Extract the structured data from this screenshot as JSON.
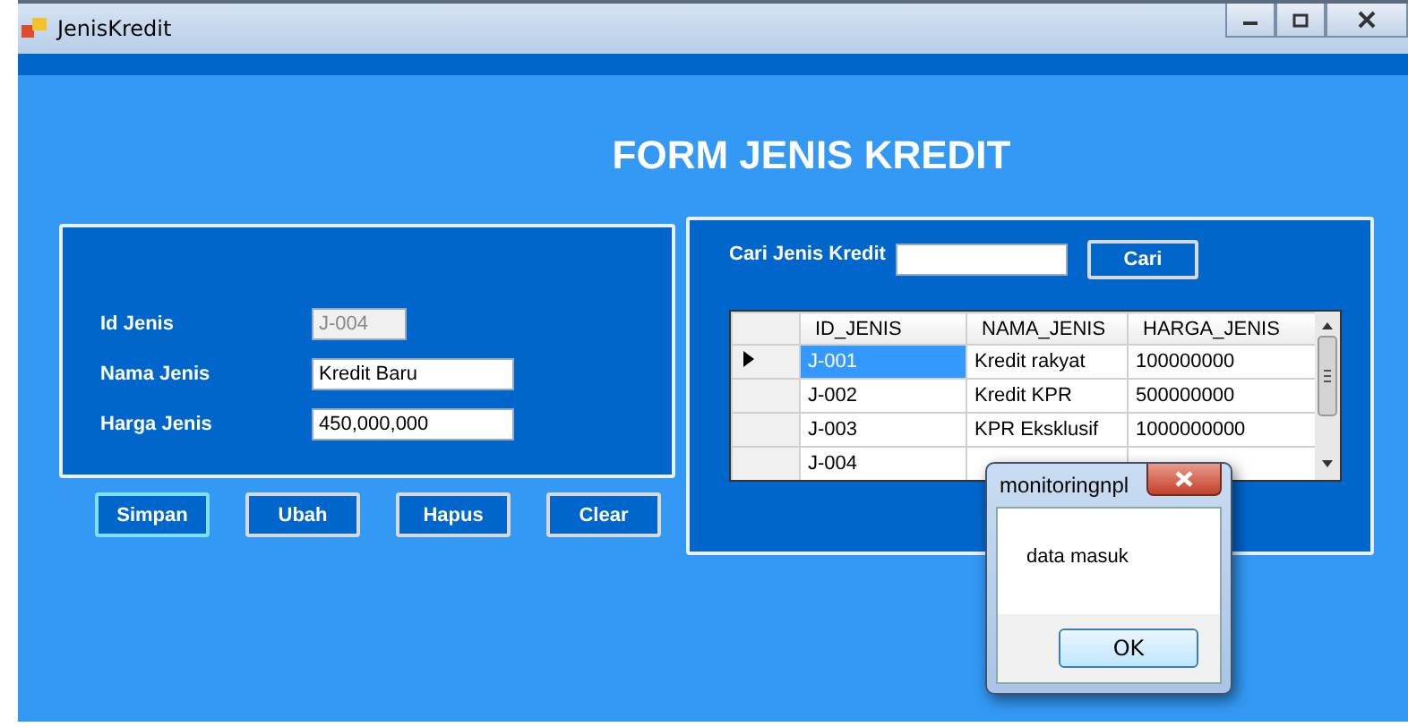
{
  "window": {
    "title": "JenisKredit"
  },
  "heading": "FORM JENIS KREDIT",
  "form": {
    "fields": [
      {
        "label": "Id Jenis",
        "value": "J-004",
        "disabled": true
      },
      {
        "label": "Nama Jenis",
        "value": "Kredit Baru",
        "disabled": false
      },
      {
        "label": "Harga Jenis",
        "value": "450,000,000",
        "disabled": false
      }
    ]
  },
  "buttons": [
    {
      "label": "Simpan",
      "focused": true
    },
    {
      "label": "Ubah",
      "focused": false
    },
    {
      "label": "Hapus",
      "focused": false
    },
    {
      "label": "Clear",
      "focused": false
    }
  ],
  "search": {
    "label": "Cari Jenis Kredit",
    "button": "Cari"
  },
  "table": {
    "columns": [
      "ID_JENIS",
      "NAMA_JENIS",
      "HARGA_JENIS"
    ],
    "rows": [
      {
        "cells": [
          "J-001",
          "Kredit rakyat",
          "100000000"
        ],
        "selected": true
      },
      {
        "cells": [
          "J-002",
          "Kredit KPR",
          "500000000"
        ],
        "selected": false
      },
      {
        "cells": [
          "J-003",
          "KPR Eksklusif",
          "1000000000"
        ],
        "selected": false
      },
      {
        "cells": [
          "J-004"
        ],
        "selected": false
      }
    ]
  },
  "dialog": {
    "title": "monitoringnpl",
    "message": "data masuk",
    "button": "OK"
  }
}
